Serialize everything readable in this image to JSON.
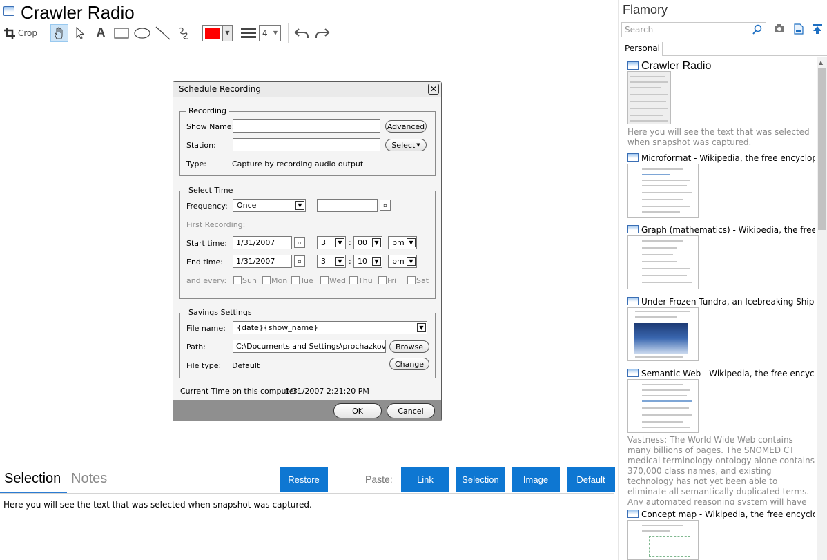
{
  "app": {
    "title": "Crawler Radio"
  },
  "toolbar": {
    "crop_label": "Crop",
    "stroke_width": "4",
    "color": "#ff0000"
  },
  "dialog": {
    "title": "Schedule Recording",
    "recording": {
      "legend": "Recording",
      "show_name_label": "Show Name:",
      "show_name_value": "",
      "advanced_button": "Advanced",
      "station_label": "Station:",
      "station_value": "",
      "select_button": "Select",
      "type_label": "Type:",
      "type_value": "Capture by recording audio output"
    },
    "select_time": {
      "legend": "Select Time",
      "frequency_label": "Frequency:",
      "frequency_value": "Once",
      "first_recording_label": "First Recording:",
      "start_label": "Start time:",
      "start_date": "1/31/2007",
      "start_hour": "3",
      "start_min": "00",
      "start_ampm": "pm",
      "end_label": "End time:",
      "end_date": "1/31/2007",
      "end_hour": "3",
      "end_min": "10",
      "end_ampm": "pm",
      "every_label": "and every:",
      "days": [
        "Sun",
        "Mon",
        "Tue",
        "Wed",
        "Thu",
        "Fri",
        "Sat"
      ]
    },
    "savings": {
      "legend": "Savings Settings",
      "file_name_label": "File name:",
      "file_name_value": "{date}{show_name}",
      "path_label": "Path:",
      "path_value": "C:\\Documents and Settings\\prochazkova\\My",
      "browse_button": "Browse",
      "file_type_label": "File type:",
      "file_type_value": "Default",
      "change_button": "Change"
    },
    "current_time_label": "Current Time on this computer:",
    "current_time_value": "1/31/2007 2:21:20 PM",
    "ok_button": "OK",
    "cancel_button": "Cancel"
  },
  "bottom": {
    "tabs": {
      "selection": "Selection",
      "notes": "Notes"
    },
    "restore_button": "Restore",
    "paste_label": "Paste:",
    "paste_buttons": {
      "link": "Link",
      "selection": "Selection",
      "image": "Image",
      "default": "Default"
    },
    "selection_text": "Here you will see the text that was selected when snapshot was captured."
  },
  "sidebar": {
    "title": "Flamory",
    "search_placeholder": "Search",
    "tab": "Personal",
    "snapshots": [
      {
        "title": "Crawler Radio",
        "desc": "Here you will see the text that was selected when snapshot was captured."
      },
      {
        "title": "Microformat - Wikipedia, the free encyclopedia"
      },
      {
        "title": "Graph (mathematics) - Wikipedia, the free ency"
      },
      {
        "title": "Under Frozen Tundra, an Icebreaking Ship Unco"
      },
      {
        "title": "Semantic Web - Wikipedia, the free encycloped",
        "desc": "Vastness: The World Wide Web contains many billions of pages. The SNOMED CT medical terminology ontology alone contains 370,000 class names, and existing technology has not yet been able to eliminate all semantically duplicated terms. Any automated reasoning system will have to deal with truly huge inputs."
      },
      {
        "title": "Concept map - Wikipedia, the free encyclopedia"
      }
    ]
  },
  "colors": {
    "accent": "#0e77d2",
    "dialog_footer": "#8f8f8f",
    "pen": "#ff0000"
  }
}
